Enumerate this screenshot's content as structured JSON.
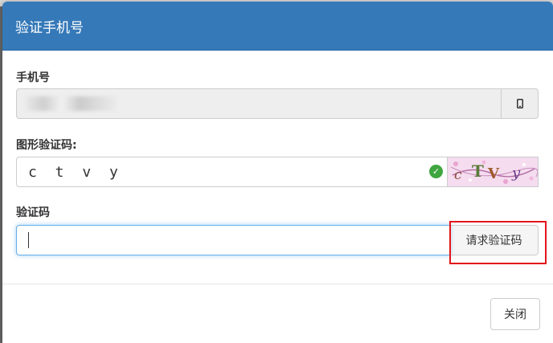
{
  "modal": {
    "title": "验证手机号",
    "phone": {
      "label": "手机号",
      "value": "",
      "icon": "mobile-phone-icon"
    },
    "captcha": {
      "label": "图形验证码:",
      "value": "c t v y",
      "status_icon": "check-circle-icon",
      "image_alt": "captcha-image"
    },
    "sms_code": {
      "label": "验证码",
      "value": "",
      "request_button": "请求验证码"
    },
    "footer": {
      "close_button": "关闭"
    }
  },
  "colors": {
    "header": "#3579b8",
    "highlight": "#e3151b",
    "success": "#3fa63f"
  }
}
